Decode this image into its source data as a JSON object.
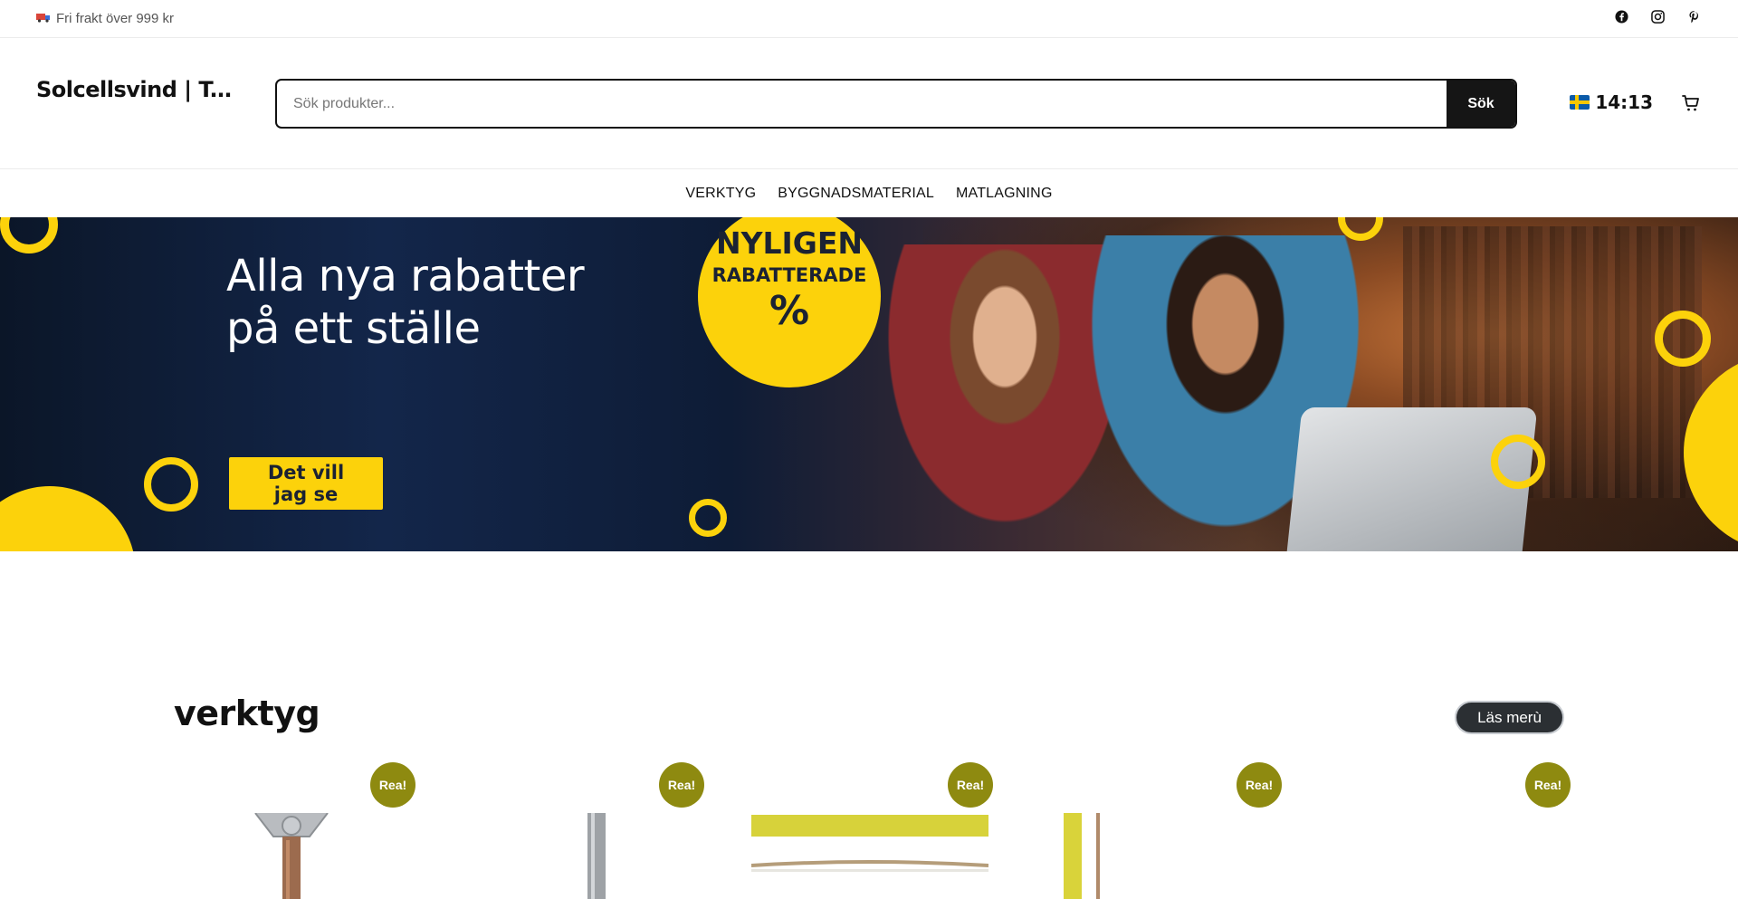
{
  "topbar": {
    "shipping_text": "Fri frakt över 999 kr",
    "truck_icon": "truck-icon",
    "social": [
      "facebook-icon",
      "instagram-icon",
      "pinterest-icon"
    ]
  },
  "header": {
    "logo": "Solcellsvind | Top…",
    "search_placeholder": "Sök produkter...",
    "search_button": "Sök",
    "time": "14:13"
  },
  "nav": {
    "items": [
      "VERKTYG",
      "BYGGNADSMATERIAL",
      "MATLAGNING"
    ]
  },
  "banner": {
    "headline_line1": "Alla nya rabatter",
    "headline_line2": "på ett ställe",
    "badge_line1": "NYLIGEN",
    "badge_line2": "RABATTERADE",
    "badge_line3": "%",
    "cta_line1": "Det vill",
    "cta_line2": "jag se",
    "accent_color": "#fcd20b",
    "dark_color": "#0b1628"
  },
  "section": {
    "title": "verktyg",
    "read_more": "Läs merù"
  },
  "products": [
    {
      "sale_label": "Rea!"
    },
    {
      "sale_label": "Rea!"
    },
    {
      "sale_label": "Rea!"
    },
    {
      "sale_label": "Rea!"
    },
    {
      "sale_label": "Rea!"
    }
  ]
}
